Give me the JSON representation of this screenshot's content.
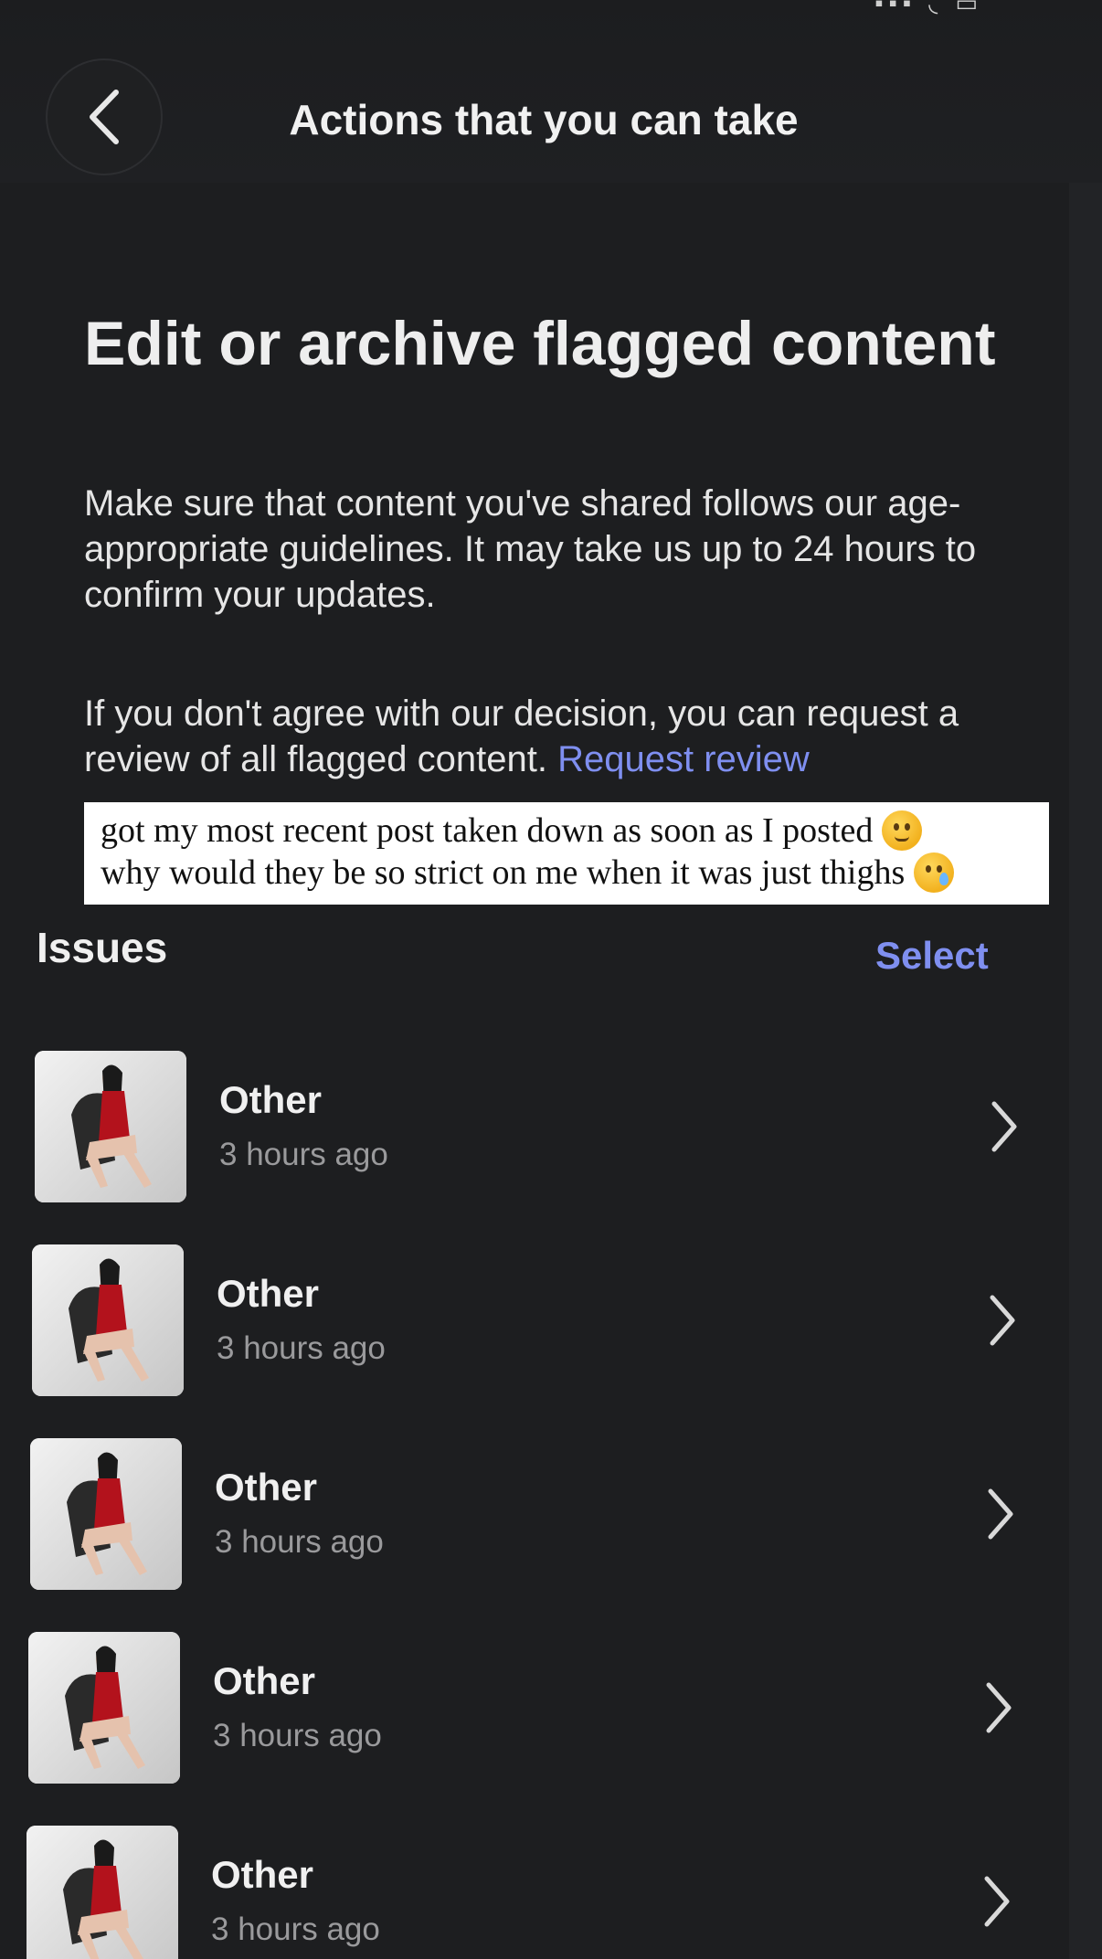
{
  "header": {
    "title": "Actions that you can take",
    "back_icon": "chevron-left-icon"
  },
  "content": {
    "title": "Edit or archive flagged content",
    "paragraph1": "Make sure that content you've shared follows our age-appropriate guidelines. It may take us up to 24 hours to confirm your updates.",
    "paragraph2_text": "If you don't agree with our decision, you can request a review of all flagged content. ",
    "paragraph2_link": "Request review"
  },
  "caption": {
    "line1": "got my most recent post taken down as soon as I posted",
    "line2": "why would they be so strict on me when it was just thighs",
    "emoji1": "melting-face-emoji",
    "emoji2": "sad-tear-face-emoji"
  },
  "issues": {
    "title": "Issues",
    "select_label": "Select",
    "items": [
      {
        "label": "Other",
        "time": "3 hours ago",
        "thumbnail": "photo-thumbnail"
      },
      {
        "label": "Other",
        "time": "3 hours ago",
        "thumbnail": "photo-thumbnail"
      },
      {
        "label": "Other",
        "time": "3 hours ago",
        "thumbnail": "photo-thumbnail"
      },
      {
        "label": "Other",
        "time": "3 hours ago",
        "thumbnail": "photo-thumbnail"
      },
      {
        "label": "Other",
        "time": "3 hours ago",
        "thumbnail": "photo-thumbnail"
      }
    ]
  },
  "colors": {
    "background": "#1d1e20",
    "accent": "#7f8ff0",
    "text_secondary": "#9a9a9c"
  }
}
